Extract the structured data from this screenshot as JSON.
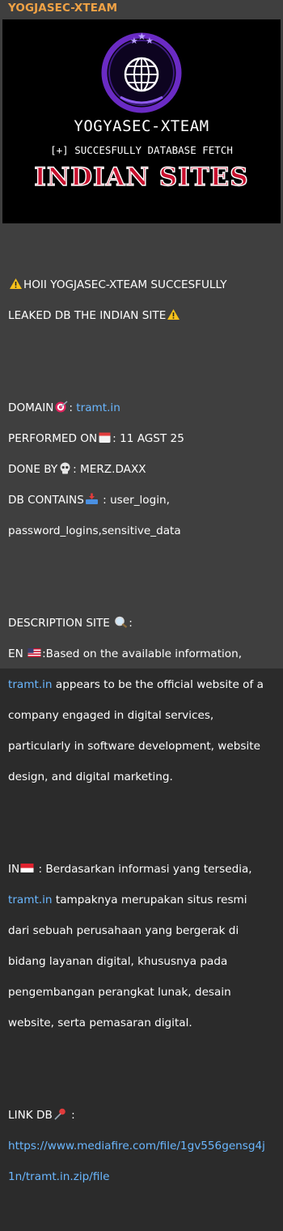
{
  "message": {
    "sender": "YOGJASEC-XTEAM",
    "banner": {
      "title": "YOGYASEC-XTEAM",
      "subtitle": "[+] SUCCESFULLY DATABASE FETCH",
      "headline": "INDIAN SITES"
    },
    "intro": {
      "line1": "HOII YOGJASEC-XTEAM SUCCESFULLY",
      "line2": "LEAKED DB THE INDIAN SITE"
    },
    "details": {
      "domain_label": "DOMAIN",
      "domain_sep": ": ",
      "domain_value": "tramt.in",
      "performed_label": "PERFORMED ON",
      "performed_value": ": 11 AGST 25",
      "done_label": "DONE BY",
      "done_value": ": MERZ.DAXX",
      "db_label": "DB CONTAINS",
      "db_value_1": " : user_login,",
      "db_value_2": "password_logins,sensitive_data"
    },
    "description": {
      "heading": "DESCRIPTION SITE",
      "heading_suffix": ":",
      "en_prefix": "EN ",
      "en_text_1": ":Based on the available information,",
      "en_link": "tramt.in",
      "en_text_2": " appears to be the official website of a",
      "en_text_3": "company engaged in digital services,",
      "en_text_4": "particularly in software development, website",
      "en_text_5": "design, and digital marketing.",
      "in_prefix": "IN",
      "in_text_1": " : Berdasarkan informasi yang tersedia,",
      "in_link": "tramt.in",
      "in_text_2": " tampaknya merupakan situs resmi",
      "in_text_3": "dari sebuah perusahaan yang bergerak di",
      "in_text_4": "bidang layanan digital, khususnya pada",
      "in_text_5": "pengembangan perangkat lunak, desain",
      "in_text_6": "website, serta pemasaran digital."
    },
    "link_section": {
      "label": "LINK DB",
      "label_suffix": " :",
      "url_line1": "https://www.mediafire.com/file/1gv556gensg4j",
      "url_line2": "1n/tramt.in.zip/file"
    }
  },
  "icons": [
    "warning-icon",
    "dart-icon",
    "calendar-icon",
    "skull-icon",
    "inbox-tray-icon",
    "magnifier-icon",
    "us-flag-icon",
    "indonesia-flag-icon",
    "pushpin-icon",
    "globe-logo-icon"
  ],
  "colors": {
    "bubble_bg": "#3f3f3f",
    "sender": "#f0a245",
    "link": "#6ab7ff",
    "banner_purple": "#6a2bc4",
    "headline_red": "#c8102e"
  }
}
